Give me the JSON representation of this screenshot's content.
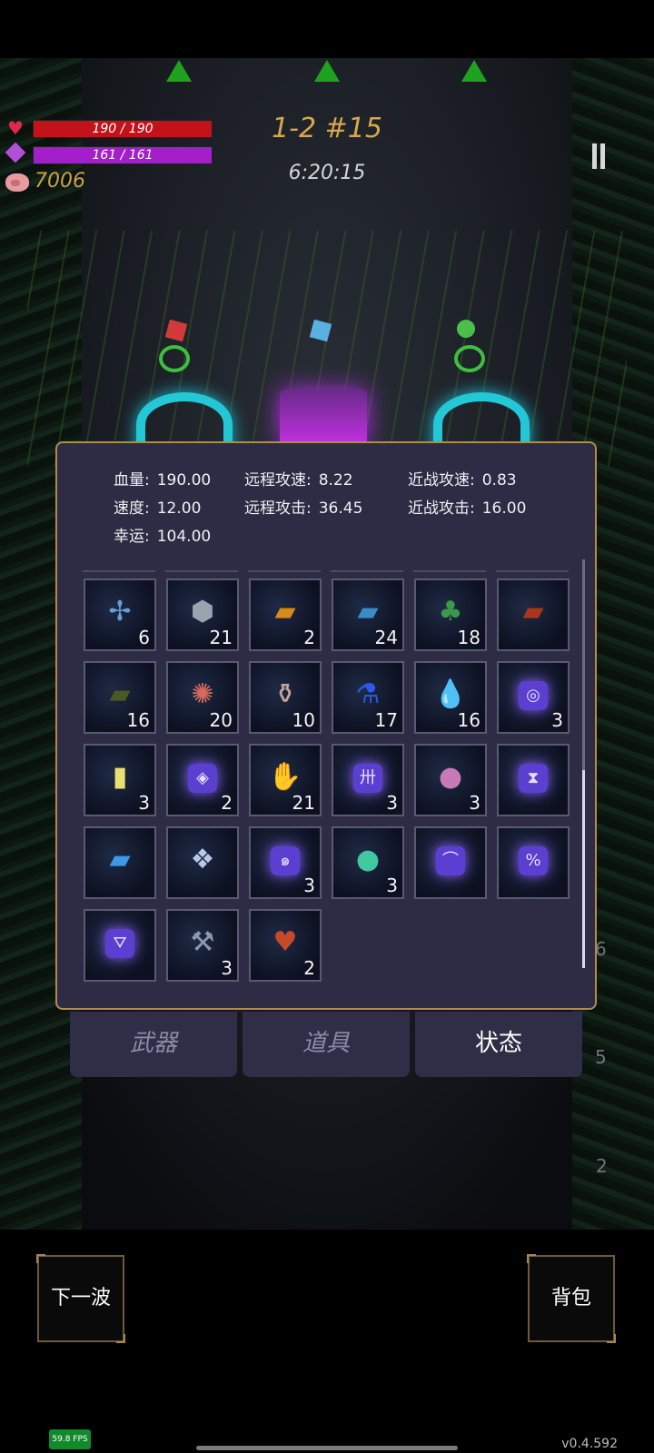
{
  "hud": {
    "hp_text": "190 / 190",
    "hp_fraction": 1.0,
    "mp_text": "161 / 161",
    "mp_fraction": 1.0,
    "gold": "7006",
    "level": "1-2 #15",
    "timer": "6:20:15",
    "colors": {
      "hp": "#c4121a",
      "mp": "#a31fc9",
      "gold": "#c9a24a",
      "level": "#d8a64c"
    }
  },
  "stats": {
    "hp": {
      "label": "血量:",
      "value": "190.00"
    },
    "speed": {
      "label": "速度:",
      "value": "12.00"
    },
    "luck": {
      "label": "幸运:",
      "value": "104.00"
    },
    "ranged_as": {
      "label": "远程攻速:",
      "value": "8.22"
    },
    "ranged_atk": {
      "label": "远程攻击:",
      "value": "36.45"
    },
    "melee_as": {
      "label": "近战攻速:",
      "value": "0.83"
    },
    "melee_atk": {
      "label": "近战攻击:",
      "value": "16.00"
    }
  },
  "items": [
    {
      "icon": "dragonfly-icon",
      "glyph": "✢",
      "color": "#6a9ad8",
      "count": "6"
    },
    {
      "icon": "stone-icon",
      "glyph": "⬢",
      "color": "#9aa4b0",
      "count": "21"
    },
    {
      "icon": "fire-book-icon",
      "glyph": "▰",
      "color": "#d88a1a",
      "count": "2"
    },
    {
      "icon": "blue-book-icon",
      "glyph": "▰",
      "color": "#3a8ac8",
      "count": "24"
    },
    {
      "icon": "clover-icon",
      "glyph": "♣",
      "color": "#3a9a4a",
      "count": "18"
    },
    {
      "icon": "skull-book-icon",
      "glyph": "▰",
      "color": "#a8381a",
      "count": ""
    },
    {
      "icon": "green-skull-book-icon",
      "glyph": "▰",
      "color": "#4a5a22",
      "count": "16"
    },
    {
      "icon": "spiky-skull-icon",
      "glyph": "✺",
      "color": "#d86a5a",
      "count": "20"
    },
    {
      "icon": "vase-icon",
      "glyph": "⚱",
      "color": "#c8a898",
      "count": "10"
    },
    {
      "icon": "blue-potion-icon",
      "glyph": "⚗",
      "color": "#2a5ae8",
      "count": "17"
    },
    {
      "icon": "water-drop-icon",
      "glyph": "💧",
      "color": "#3a9ae0",
      "count": "16"
    },
    {
      "icon": "spiral-rune-icon",
      "rune": "◎",
      "count": "3"
    },
    {
      "icon": "yellow-card-icon",
      "glyph": "▮",
      "color": "#e8e070",
      "count": "3"
    },
    {
      "icon": "eye-rune-icon",
      "rune": "◈",
      "count": "2"
    },
    {
      "icon": "gloves-icon",
      "glyph": "✋",
      "color": "#a84a3a",
      "count": "21"
    },
    {
      "icon": "cross-rune-icon",
      "rune": "卅",
      "count": "3"
    },
    {
      "icon": "slime-icon",
      "glyph": "●",
      "color": "#c87ab8",
      "count": "3"
    },
    {
      "icon": "hourglass-rune-icon",
      "rune": "⧗",
      "count": ""
    },
    {
      "icon": "triangle-book-icon",
      "glyph": "▰",
      "color": "#3a9ae8",
      "count": ""
    },
    {
      "icon": "crystal-shard-icon",
      "glyph": "❖",
      "color": "#b8c8e8",
      "count": ""
    },
    {
      "icon": "swirl-rune-icon",
      "rune": "๑",
      "count": "3"
    },
    {
      "icon": "rainbow-orb-icon",
      "glyph": "●",
      "color": "#40c8a0",
      "count": "3"
    },
    {
      "icon": "curve-rune-icon",
      "rune": "⌒",
      "count": ""
    },
    {
      "icon": "percent-rune-icon",
      "rune": "%",
      "count": ""
    },
    {
      "icon": "triangle-rune-icon",
      "rune": "⛛",
      "count": ""
    },
    {
      "icon": "hammer-icon",
      "glyph": "⚒",
      "color": "#8a9ab0",
      "count": "3"
    },
    {
      "icon": "heart-bag-icon",
      "glyph": "♥",
      "color": "#c8482a",
      "count": "2"
    }
  ],
  "tabs": [
    {
      "label": "武器",
      "active": false
    },
    {
      "label": "道具",
      "active": false
    },
    {
      "label": "状态",
      "active": true
    }
  ],
  "buttons": {
    "next_wave": "下一波",
    "backpack": "背包"
  },
  "side_numbers": [
    "6",
    "5",
    "2"
  ],
  "fps": "59.8 FPS",
  "version": "v0.4.592"
}
